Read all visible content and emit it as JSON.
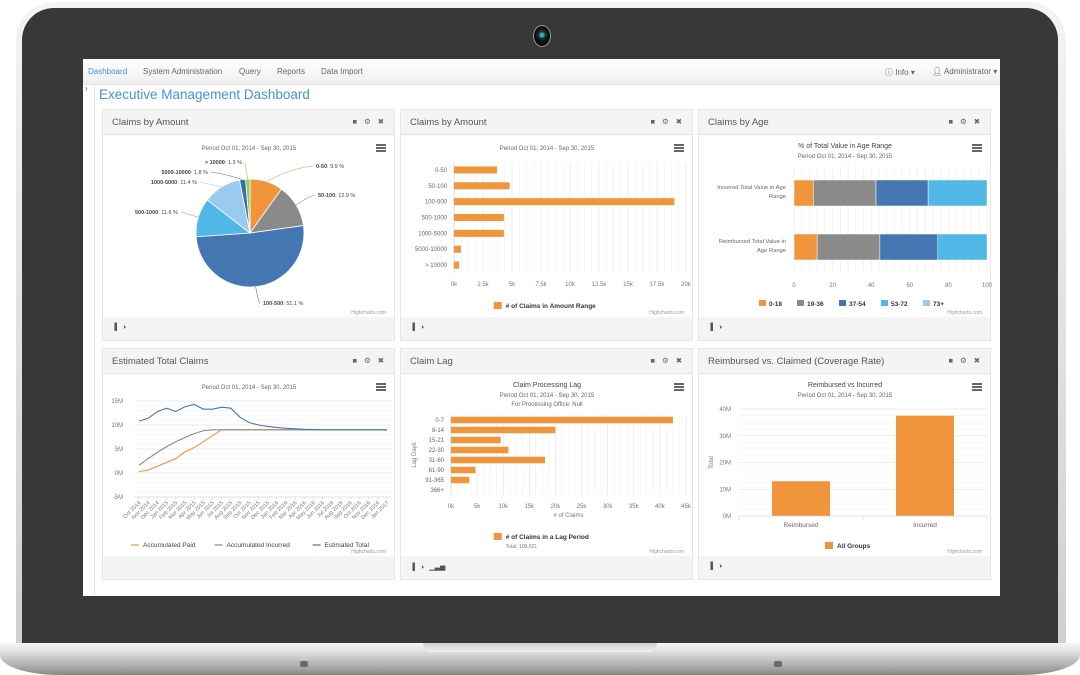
{
  "nav": {
    "items": [
      "Dashboard",
      "System Administration",
      "Query",
      "Reports",
      "Data Import"
    ],
    "active": "Dashboard",
    "info_label": "Info",
    "user_label": "Administrator"
  },
  "page_title": "Executive Management Dashboard",
  "colors": {
    "accent": "#4a90d9",
    "orange": "#f0953c",
    "gray": "#8a8a8a",
    "darkblue": "#4477b1",
    "lightblue": "#51b7e6",
    "paleblue": "#9acbef",
    "green": "#8bd05a"
  },
  "credit": "Highcharts.com",
  "panels": [
    {
      "title": "Claims by Amount",
      "foot_icons": [
        "bar-signal",
        "contrast"
      ]
    },
    {
      "title": "Claims by Amount",
      "foot_icons": [
        "bar-signal",
        "contrast"
      ]
    },
    {
      "title": "Claims by Age",
      "foot_icons": [
        "bar-signal",
        "contrast"
      ]
    },
    {
      "title": "Estimated Total Claims",
      "foot_icons": []
    },
    {
      "title": "Claim Lag",
      "foot_icons": [
        "bar-signal",
        "contrast",
        "bar-chart"
      ]
    },
    {
      "title": "Reimbursed vs. Claimed (Coverage Rate)",
      "foot_icons": [
        "bar-signal",
        "contrast"
      ]
    }
  ],
  "chart_data": [
    {
      "type": "pie",
      "title": "",
      "subtitle": "Period Oct 01, 2014 - Sep 30, 2015",
      "slices": [
        {
          "label": "0-50",
          "value": 9.9,
          "color": "#f0953c"
        },
        {
          "label": "50-100",
          "value": 12.9,
          "color": "#8a8a8a"
        },
        {
          "label": "100-500",
          "value": 51.1,
          "color": "#4477b1"
        },
        {
          "label": "500-1000",
          "value": 11.6,
          "color": "#51b7e6"
        },
        {
          "label": "1000-5000",
          "value": 11.4,
          "color": "#9acbef"
        },
        {
          "label": "5000-10000",
          "value": 1.8,
          "color": "#3d6ea8"
        },
        {
          "label": "> 10000",
          "value": 1.3,
          "color": "#8bd05a"
        }
      ]
    },
    {
      "type": "bar",
      "orientation": "horizontal",
      "title": "",
      "subtitle": "Period Oct 01, 2014 - Sep 30, 2015",
      "categories": [
        "0-50",
        "50-100",
        "100-500",
        "500-1000",
        "1000-5000",
        "5000-10000",
        "> 10000"
      ],
      "values": [
        3700,
        4800,
        19000,
        4300,
        4300,
        600,
        450
      ],
      "xlim": [
        0,
        20000
      ],
      "ticks": [
        "0k",
        "2.5k",
        "5k",
        "7.5k",
        "10k",
        "12.5k",
        "15k",
        "17.5k",
        "20k"
      ],
      "legend": [
        "# of Claims in Amount Range"
      ],
      "legend_position": "bottom"
    },
    {
      "type": "bar",
      "orientation": "horizontal-stacked-percent",
      "title": "% of Total Value in Age Range",
      "subtitle": "Period Oct 01, 2014 - Sep 30, 2015",
      "categories": [
        "Incurred Total Value in Age Range",
        "Reimbursed Total Value in Age Range"
      ],
      "series": [
        {
          "name": "0-18",
          "values": [
            10,
            12
          ],
          "color": "#f0953c"
        },
        {
          "name": "19-36",
          "values": [
            32.5,
            32.5
          ],
          "color": "#8a8a8a"
        },
        {
          "name": "37-54",
          "values": [
            27,
            30
          ],
          "color": "#4477b1"
        },
        {
          "name": "53-72",
          "values": [
            30.5,
            25.5
          ],
          "color": "#51b7e6"
        },
        {
          "name": "73+",
          "values": [
            0,
            0
          ],
          "color": "#9acbef"
        }
      ],
      "xlim": [
        0,
        100
      ],
      "ticks": [
        "0",
        "20",
        "40",
        "60",
        "80",
        "100"
      ],
      "legend_position": "bottom"
    },
    {
      "type": "line",
      "title": "",
      "subtitle": "Period Oct 01, 2014 - Sep 30, 2015",
      "x": [
        "Oct 2014",
        "Nov 2014",
        "Dec 2014",
        "Jan 2015",
        "Feb 2015",
        "Mar 2015",
        "Apr 2015",
        "May 2015",
        "Jun 2015",
        "Jul 2015",
        "Aug 2015",
        "Sep 2015",
        "Oct 2015",
        "Nov 2015",
        "Dec 2015",
        "Jan 2016",
        "Feb 2016",
        "Mar 2016",
        "Apr 2016",
        "May 2016",
        "Jun 2016",
        "Jul 2016",
        "Aug 2016",
        "Sep 2016",
        "Oct 2016",
        "Nov 2016",
        "Dec 2016",
        "Jan 2017"
      ],
      "ylim": [
        -5,
        15
      ],
      "yticks": [
        "-5M",
        "0M",
        "5M",
        "10M",
        "15M"
      ],
      "series": [
        {
          "name": "Accumulated Paid",
          "color": "#f0953c",
          "values": [
            0.3,
            0.6,
            1.4,
            2.2,
            3.0,
            4.4,
            5.3,
            6.5,
            7.8,
            9.0,
            9.0,
            9.0,
            9.0,
            9.0,
            9.0,
            9.0,
            9.0,
            9.0,
            9.0,
            9.0,
            9.0,
            9.0,
            9.0,
            9.0,
            9.0,
            9.0,
            9.0,
            9.0
          ]
        },
        {
          "name": "Accumulated Incurred",
          "color": "#8a8a8a",
          "values": [
            1.6,
            3.0,
            4.3,
            5.5,
            6.5,
            7.4,
            8.2,
            8.8,
            9.0,
            9.0,
            9.0,
            9.0,
            9.0,
            9.0,
            9.0,
            9.0,
            9.0,
            9.0,
            9.0,
            9.0,
            9.0,
            9.0,
            9.0,
            9.0,
            9.0,
            9.0,
            9.0,
            9.0
          ]
        },
        {
          "name": "Estimated Total",
          "color": "#4477b1",
          "values": [
            10.8,
            11.4,
            12.8,
            13.5,
            12.8,
            13.8,
            14.3,
            13.3,
            13.3,
            13.7,
            13.5,
            11.6,
            10.5,
            10.0,
            9.7,
            9.5,
            9.3,
            9.2,
            9.1,
            9.05,
            9.0,
            9.0,
            9.0,
            9.0,
            9.0,
            9.0,
            9.0,
            9.0
          ]
        }
      ],
      "legend_position": "bottom"
    },
    {
      "type": "bar",
      "orientation": "horizontal",
      "title": "Claim Processing Lag",
      "subtitle": "Period Oct 01, 2014 - Sep 30, 2015",
      "subtitle2": "For Processing Office: Null",
      "ylabel": "Lag Days",
      "xlabel": "# of Claims",
      "categories": [
        "0-7",
        "8-14",
        "15-21",
        "22-30",
        "31-60",
        "61-90",
        "91-365",
        "366+"
      ],
      "values": [
        42500,
        20000,
        9500,
        11000,
        18000,
        4700,
        3500,
        0
      ],
      "xlim": [
        0,
        45000
      ],
      "ticks": [
        "0k",
        "5k",
        "10k",
        "15k",
        "20k",
        "25k",
        "30k",
        "35k",
        "40k",
        "45k"
      ],
      "legend": [
        "# of Claims in a Lag Period"
      ],
      "legend_note": "Total: 109,621",
      "legend_position": "bottom"
    },
    {
      "type": "bar",
      "orientation": "vertical",
      "title": "Reimbursed vs Incurred",
      "subtitle": "Period Oct 01, 2014 - Sep 30, 2015",
      "ylabel": "Total",
      "categories": [
        "Reimbursed",
        "Incurred"
      ],
      "values": [
        13,
        37.5
      ],
      "ylim": [
        0,
        40
      ],
      "yticks": [
        "0M",
        "10M",
        "20M",
        "30M",
        "40M"
      ],
      "legend": [
        "All Groups"
      ],
      "legend_position": "bottom"
    }
  ]
}
